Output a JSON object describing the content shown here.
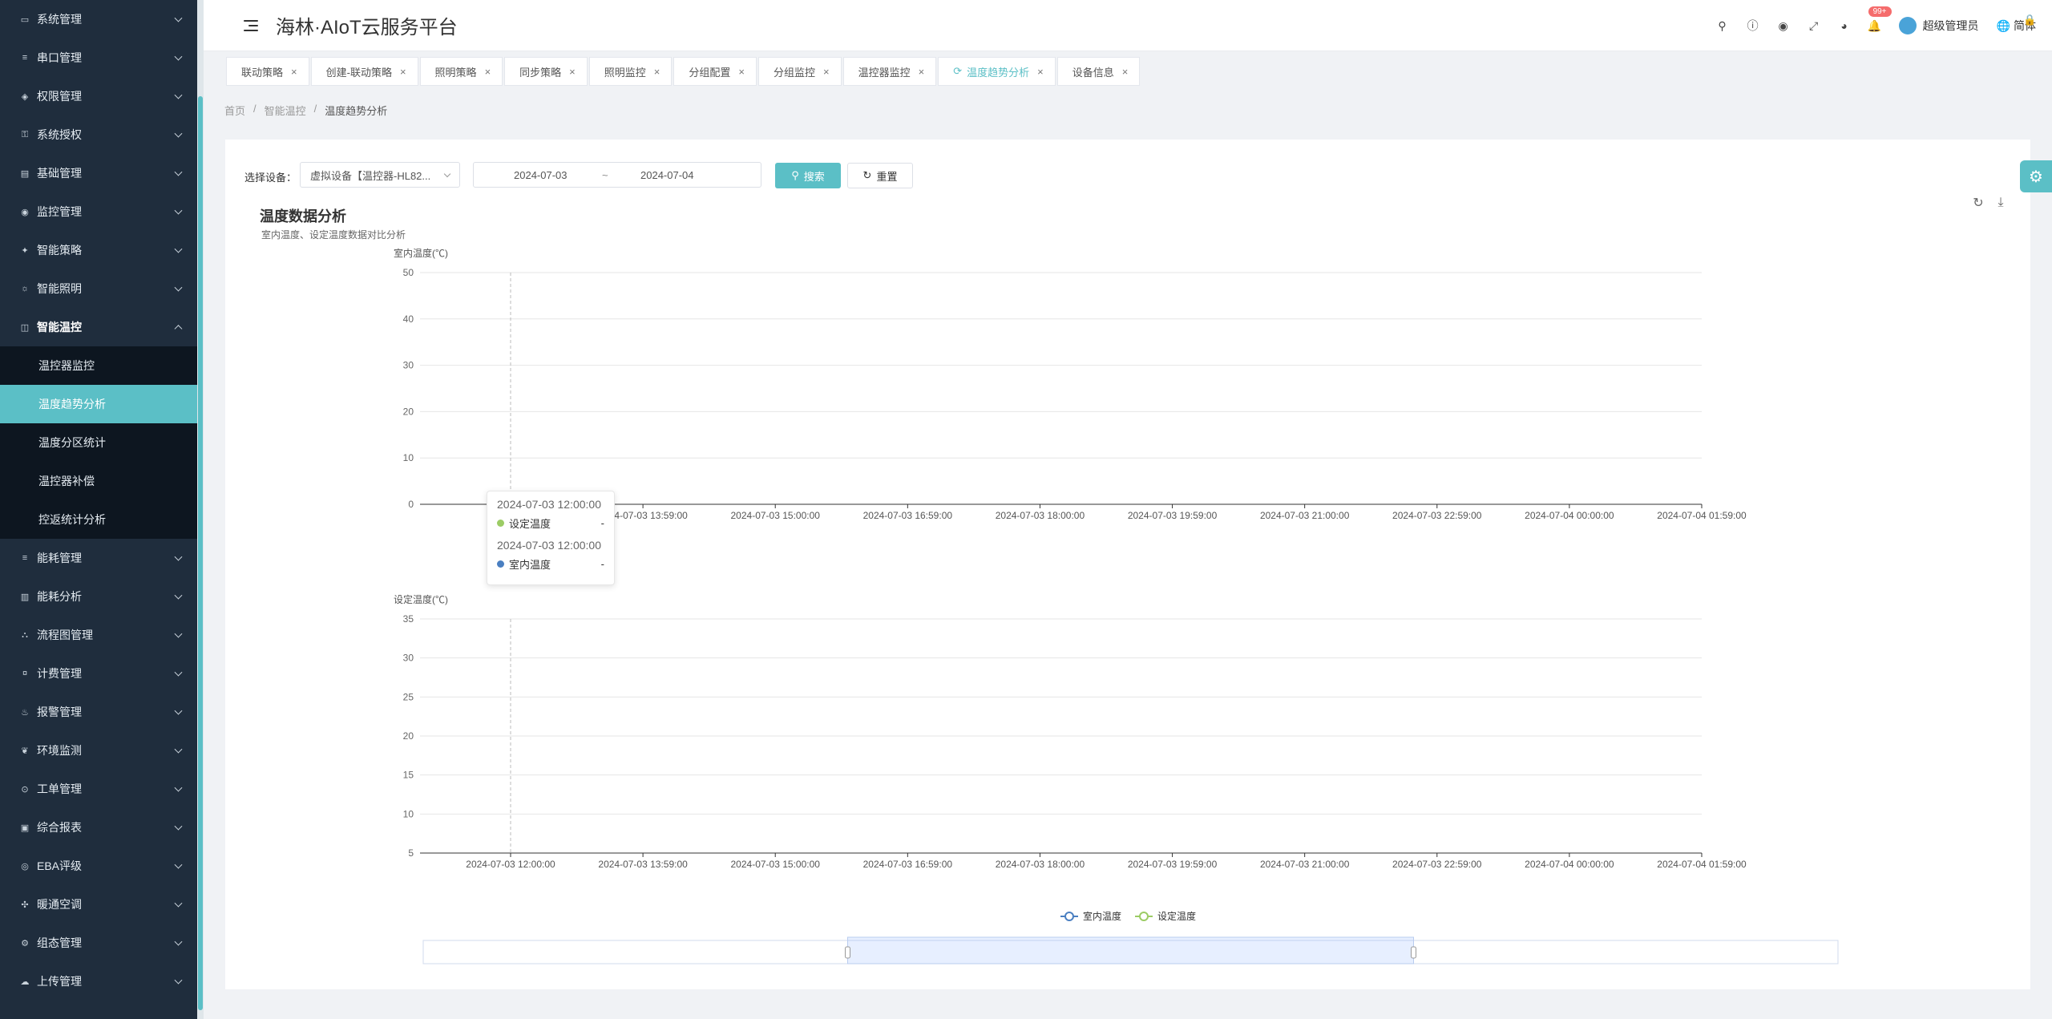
{
  "app": {
    "title": "海林·AIoT云服务平台"
  },
  "sidebar": {
    "items_top": [
      {
        "label": "系统管理",
        "icon": "monitor-icon"
      },
      {
        "label": "串口管理",
        "icon": "sliders-icon"
      },
      {
        "label": "权限管理",
        "icon": "shield-icon"
      },
      {
        "label": "系统授权",
        "icon": "key-icon"
      },
      {
        "label": "基础管理",
        "icon": "folder-icon"
      },
      {
        "label": "监控管理",
        "icon": "camera-icon"
      },
      {
        "label": "智能策略",
        "icon": "bulb-icon"
      },
      {
        "label": "智能照明",
        "icon": "light-icon"
      }
    ],
    "open_item": {
      "label": "智能温控",
      "icon": "thermo-icon"
    },
    "sub_items": [
      {
        "label": "温控器监控"
      },
      {
        "label": "温度趋势分析"
      },
      {
        "label": "温度分区统计"
      },
      {
        "label": "温控器补偿"
      },
      {
        "label": "控返统计分析"
      }
    ],
    "items_bottom": [
      {
        "label": "能耗管理",
        "icon": "sliders-icon"
      },
      {
        "label": "能耗分析",
        "icon": "bar-icon"
      },
      {
        "label": "流程图管理",
        "icon": "flow-icon"
      },
      {
        "label": "计费管理",
        "icon": "money-icon"
      },
      {
        "label": "报警管理",
        "icon": "alarm-icon"
      },
      {
        "label": "环境监测",
        "icon": "leaf-icon"
      },
      {
        "label": "工单管理",
        "icon": "ticket-icon"
      },
      {
        "label": "综合报表",
        "icon": "report-icon"
      },
      {
        "label": "EBA评级",
        "icon": "grade-icon"
      },
      {
        "label": "暖通空调",
        "icon": "fan-icon"
      },
      {
        "label": "组态管理",
        "icon": "gear-icon"
      },
      {
        "label": "上传管理",
        "icon": "cloud-icon"
      }
    ]
  },
  "header": {
    "badge": "99+",
    "user_name": "超级管理员",
    "lang": "简体"
  },
  "tabs": [
    {
      "label": "联动策略"
    },
    {
      "label": "创建-联动策略"
    },
    {
      "label": "照明策略"
    },
    {
      "label": "同步策略"
    },
    {
      "label": "照明监控"
    },
    {
      "label": "分组配置"
    },
    {
      "label": "分组监控"
    },
    {
      "label": "温控器监控"
    },
    {
      "label": "温度趋势分析",
      "active": true
    },
    {
      "label": "设备信息"
    }
  ],
  "breadcrumb": {
    "home": "首页",
    "parent": "智能温控",
    "current": "温度趋势分析"
  },
  "filters": {
    "device_label": "选择设备：",
    "device_value": "虚拟设备【温控器-HL82...",
    "date_start": "2024-07-03",
    "date_sep": "~",
    "date_end": "2024-07-04",
    "search_label": "搜索",
    "reset_label": "重置"
  },
  "chart_header": {
    "title": "温度数据分析",
    "subtitle": "室内温度、设定温度数据对比分析"
  },
  "tooltip": {
    "time1": "2024-07-03 12:00:00",
    "series1": "设定温度",
    "value1": "-",
    "time2": "2024-07-03 12:00:00",
    "series2": "室内温度",
    "value2": "-"
  },
  "colors": {
    "accent": "#5bbfc6",
    "indoor": "#4a7fc1",
    "setpoint": "#9ccc65"
  },
  "chart_data": [
    {
      "type": "line",
      "ylabel": "室内温度(℃)",
      "ylim": [
        0,
        50
      ],
      "yticks": [
        0,
        10,
        20,
        30,
        40,
        50
      ],
      "categories": [
        "2024-07-03 12:00:00",
        "2024-07-03 13:59:00",
        "2024-07-03 15:00:00",
        "2024-07-03 16:59:00",
        "2024-07-03 18:00:00",
        "2024-07-03 19:59:00",
        "2024-07-03 21:00:00",
        "2024-07-03 22:59:00",
        "2024-07-04 00:00:00",
        "2024-07-04 01:59:00"
      ],
      "series": [
        {
          "name": "室内温度",
          "values": [
            null,
            null,
            null,
            null,
            null,
            null,
            null,
            null,
            null,
            null
          ]
        }
      ],
      "grid": true
    },
    {
      "type": "line",
      "ylabel": "设定温度(℃)",
      "ylim": [
        5,
        35
      ],
      "yticks": [
        5,
        10,
        15,
        20,
        25,
        30,
        35
      ],
      "categories": [
        "2024-07-03 12:00:00",
        "2024-07-03 13:59:00",
        "2024-07-03 15:00:00",
        "2024-07-03 16:59:00",
        "2024-07-03 18:00:00",
        "2024-07-03 19:59:00",
        "2024-07-03 21:00:00",
        "2024-07-03 22:59:00",
        "2024-07-04 00:00:00",
        "2024-07-04 01:59:00"
      ],
      "series": [
        {
          "name": "设定温度",
          "values": [
            null,
            null,
            null,
            null,
            null,
            null,
            null,
            null,
            null,
            null
          ]
        }
      ],
      "grid": true
    }
  ],
  "legend": {
    "items": [
      "室内温度",
      "设定温度"
    ]
  },
  "datazoom": {
    "start": 0.3,
    "end": 0.7
  }
}
